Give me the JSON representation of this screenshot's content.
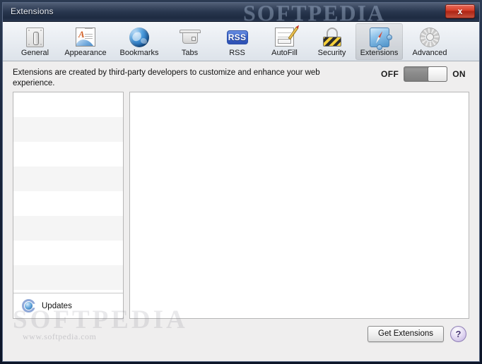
{
  "window": {
    "title": "Extensions",
    "close_label": "x",
    "watermark_title": "SOFTPEDIA",
    "watermark_body": "SOFTPEDIA",
    "watermark_url": "www.softpedia.com"
  },
  "toolbar": {
    "tabs": [
      {
        "label": "General",
        "icon": "general-icon",
        "selected": false
      },
      {
        "label": "Appearance",
        "icon": "appearance-icon",
        "selected": false
      },
      {
        "label": "Bookmarks",
        "icon": "globe-icon",
        "selected": false
      },
      {
        "label": "Tabs",
        "icon": "tabs-icon",
        "selected": false
      },
      {
        "label": "RSS",
        "icon": "rss-icon",
        "selected": false
      },
      {
        "label": "AutoFill",
        "icon": "autofill-icon",
        "selected": false
      },
      {
        "label": "Security",
        "icon": "lock-icon",
        "selected": false
      },
      {
        "label": "Extensions",
        "icon": "extensions-icon",
        "selected": true
      },
      {
        "label": "Advanced",
        "icon": "gear-icon",
        "selected": false
      }
    ],
    "rss_badge_text": "RSS"
  },
  "description": {
    "text": "Extensions are created by third-party developers to customize and enhance your web experience."
  },
  "toggle": {
    "off_label": "OFF",
    "on_label": "ON",
    "state": "OFF"
  },
  "list_panel": {
    "row_count": 9,
    "updates_label": "Updates",
    "updates_icon": "refresh-icon"
  },
  "footer": {
    "get_extensions_label": "Get Extensions",
    "help_label": "?"
  },
  "colors": {
    "accent_blue": "#2d50b4",
    "close_red": "#ad2414",
    "help_purple": "#c0aee0",
    "frame_navy": "#121c31",
    "row_alt": "#f5f5f5"
  }
}
